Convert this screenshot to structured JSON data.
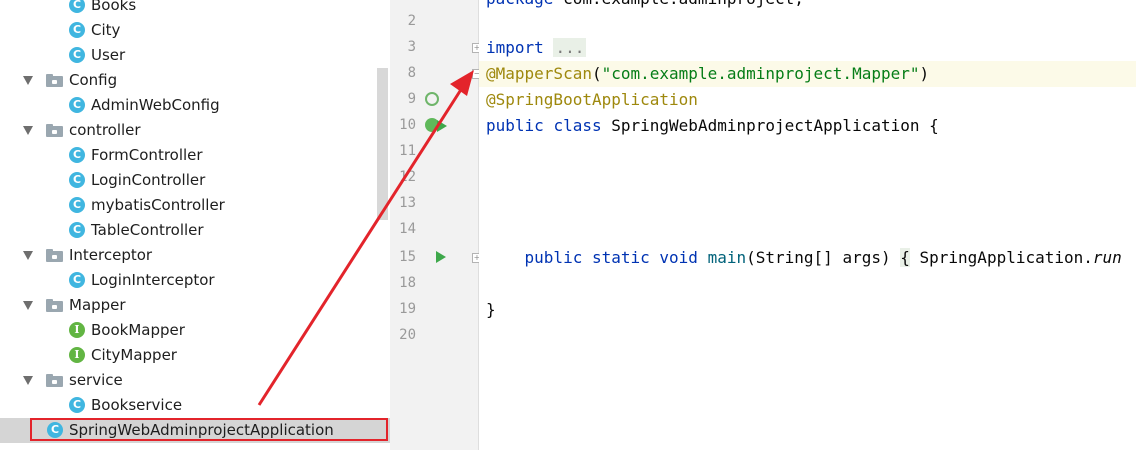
{
  "tree": {
    "items": [
      {
        "label": "Books",
        "type": "class",
        "badge": "C"
      },
      {
        "label": "City",
        "type": "class",
        "badge": "C"
      },
      {
        "label": "User",
        "type": "class",
        "badge": "C"
      },
      {
        "label": "Config",
        "type": "package"
      },
      {
        "label": "AdminWebConfig",
        "type": "class",
        "badge": "C"
      },
      {
        "label": "controller",
        "type": "package"
      },
      {
        "label": "FormController",
        "type": "class",
        "badge": "C"
      },
      {
        "label": "LoginController",
        "type": "class",
        "badge": "C"
      },
      {
        "label": "mybatisController",
        "type": "class",
        "badge": "C"
      },
      {
        "label": "TableController",
        "type": "class",
        "badge": "C"
      },
      {
        "label": "Interceptor",
        "type": "package"
      },
      {
        "label": "LoginInterceptor",
        "type": "class",
        "badge": "C"
      },
      {
        "label": "Mapper",
        "type": "package"
      },
      {
        "label": "BookMapper",
        "type": "interface",
        "badge": "I"
      },
      {
        "label": "CityMapper",
        "type": "interface",
        "badge": "I"
      },
      {
        "label": "service",
        "type": "package"
      },
      {
        "label": "Bookservice",
        "type": "class",
        "badge": "C"
      },
      {
        "label": "SpringWebAdminprojectApplication",
        "type": "app-class",
        "badge": "C",
        "selected": true
      }
    ]
  },
  "gutter": {
    "line_numbers": [
      "2",
      "3",
      "8",
      "9",
      "10",
      "11",
      "12",
      "13",
      "14",
      "15",
      "18",
      "19",
      "20"
    ]
  },
  "editor": {
    "line0": {
      "kw": "package",
      "rest": " com.example.adminproject;"
    },
    "line3": {
      "kw": "import",
      "dots": "..."
    },
    "line8": {
      "ann": "@MapperScan",
      "open": "(",
      "str": "\"com.example.adminproject.Mapper\"",
      "close": ")"
    },
    "line9": {
      "ann": "@SpringBootApplication"
    },
    "line10": {
      "kw1": "public",
      "kw2": "class",
      "name": " SpringWebAdminprojectApplication ",
      "brace": "{"
    },
    "line15": {
      "kw1": "public",
      "kw2": "static",
      "kw3": "void",
      "method": "main",
      "params": "(String[] args) ",
      "brace_open": "{",
      "body": " SpringApplication.",
      "call": "run"
    },
    "line19": {
      "brace": "}"
    }
  },
  "colors": {
    "annotation_arrow": "#e3242b",
    "keyword": "#0033b3",
    "annotation": "#9e880d",
    "string": "#067d17",
    "class_badge": "#40b6e0",
    "interface_badge": "#62b543"
  }
}
